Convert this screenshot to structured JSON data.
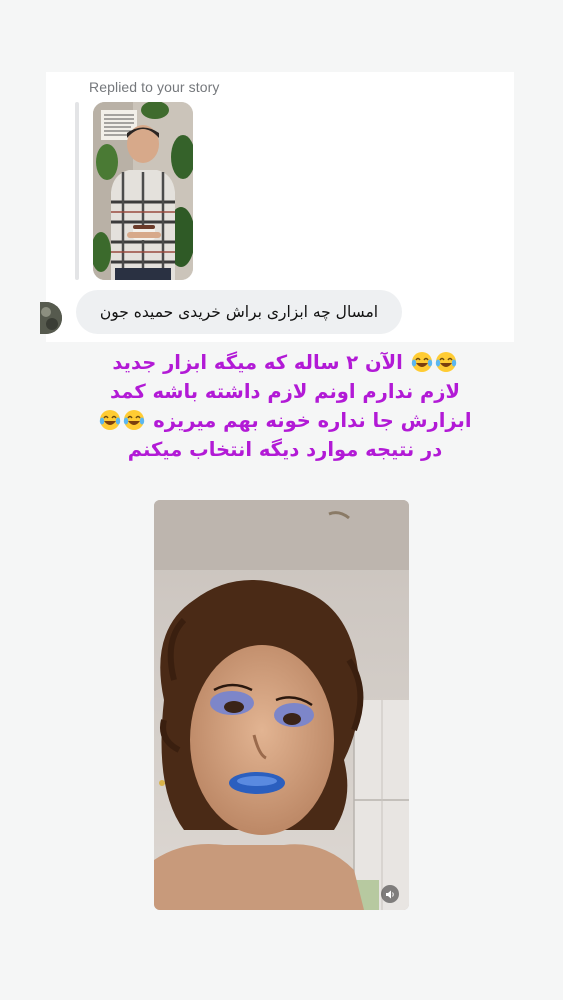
{
  "reply": {
    "label": "Replied to your story"
  },
  "message": {
    "text": "امسال چه ابزاری براش خریدی حمیده جون"
  },
  "caption": {
    "lines": [
      "الآن ۲ ساله که میگه ابزار جدید",
      "لازم ندارم  اونم لازم داشته باشه کمد",
      "ابزارش جا نداره خونه بهم میریزه",
      "در نتیجه موارد دیگه انتخاب میکنم"
    ],
    "color": "#b21ad6",
    "emoji": "face-with-tears-of-joy"
  },
  "icons": {
    "sound": "speaker-icon"
  },
  "colors": {
    "background": "#f5f6f6",
    "bubble": "#eef0f2",
    "label": "#75787c"
  }
}
